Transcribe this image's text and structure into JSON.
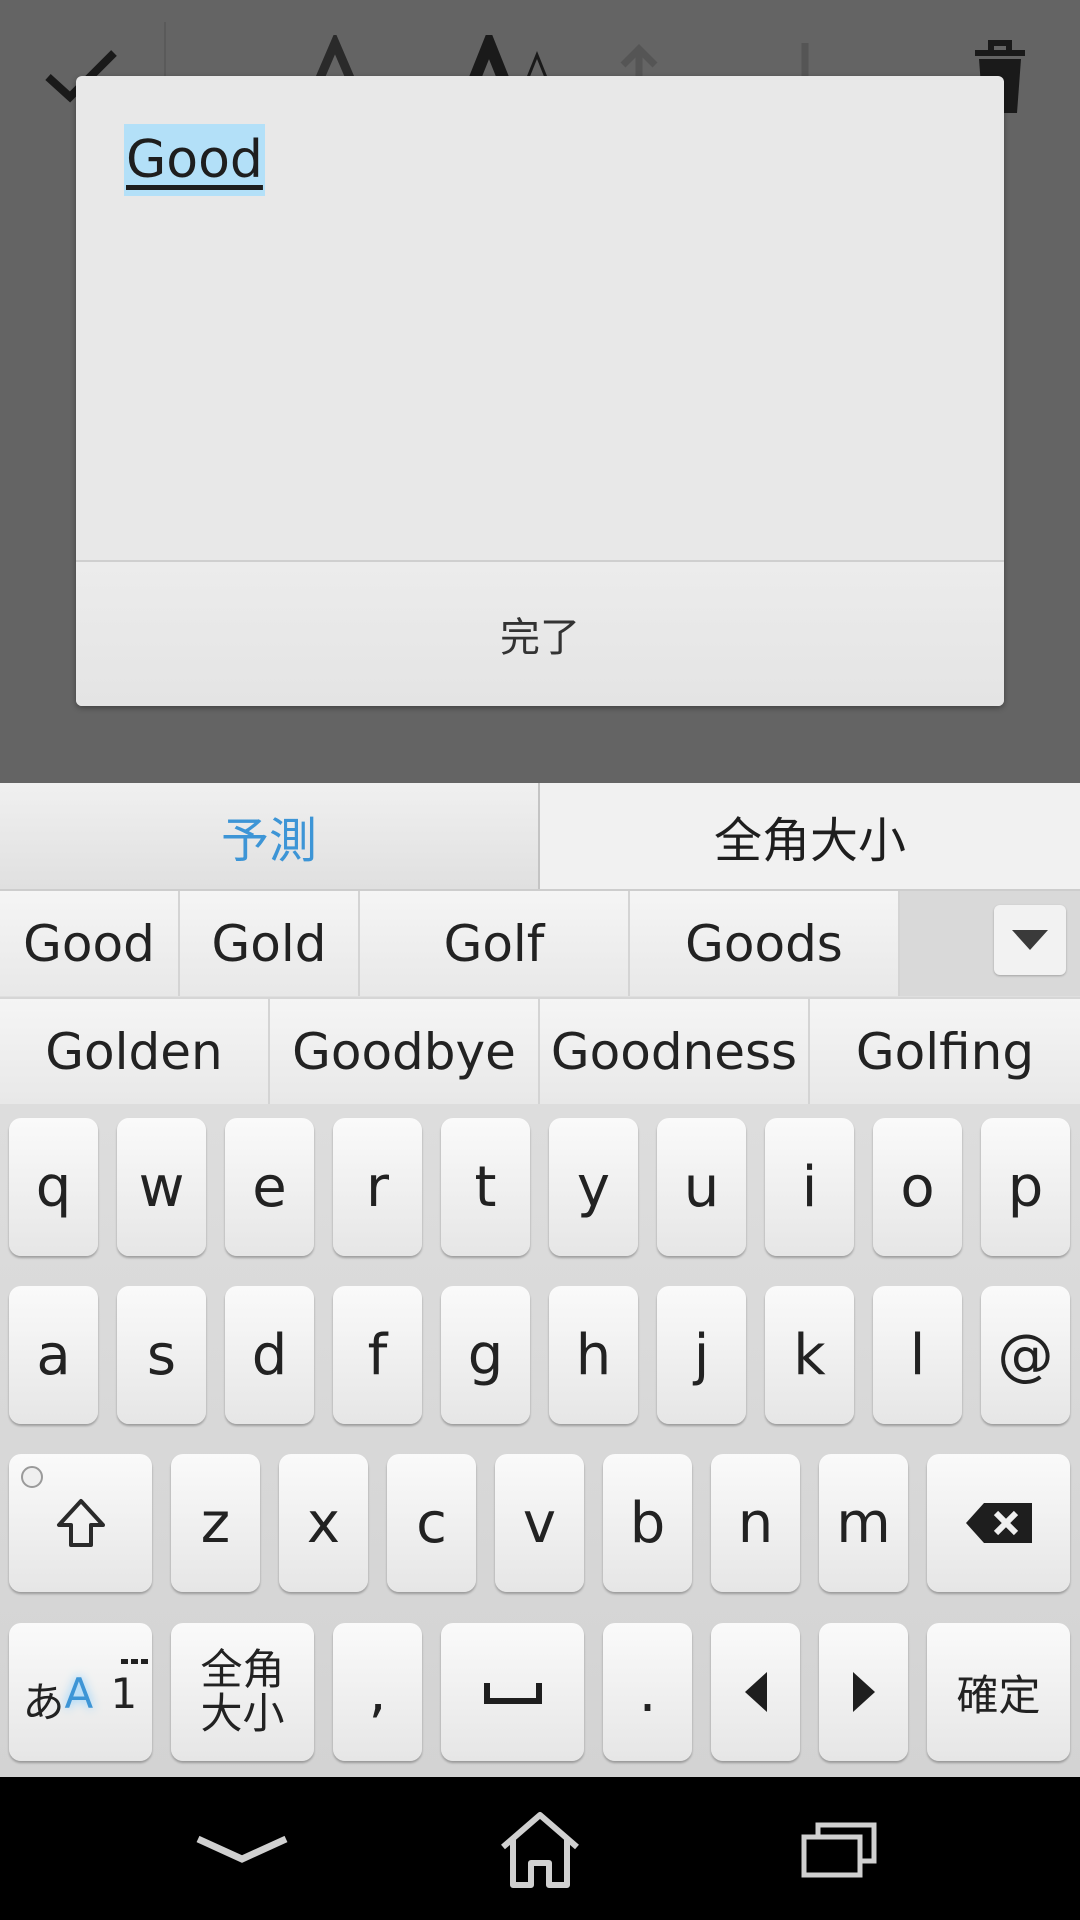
{
  "toolbar": {
    "confirm_icon": "check-icon",
    "decrease_font_icon": "font-size-decrease-icon",
    "increase_font_icon": "font-size-increase-icon",
    "bring_forward_icon": "bring-forward-icon",
    "send_backward_icon": "send-backward-icon",
    "delete_icon": "trash-icon"
  },
  "dialog": {
    "input_text": "Good",
    "done_label": "完了"
  },
  "keyboard": {
    "mode_tabs": [
      {
        "label": "予測",
        "active": true
      },
      {
        "label": "全角大小",
        "active": false
      }
    ],
    "candidates_row1": [
      "Good",
      "Gold",
      "Golf",
      "Goods"
    ],
    "candidates_row2": [
      "Golden",
      "Goodbye",
      "Goodness",
      "Golfing"
    ],
    "expand_icon": "triangle-down-icon",
    "row1": [
      "q",
      "w",
      "e",
      "r",
      "t",
      "y",
      "u",
      "i",
      "o",
      "p"
    ],
    "row2": [
      "a",
      "s",
      "d",
      "f",
      "g",
      "h",
      "j",
      "k",
      "l",
      "@"
    ],
    "row3": [
      "z",
      "x",
      "c",
      "v",
      "b",
      "n",
      "m"
    ],
    "shift_icon": "shift-icon",
    "backspace_icon": "backspace-icon",
    "bottom": {
      "input_mode": {
        "hira": "あ",
        "alpha": "A",
        "num": "1"
      },
      "zenkaku_line1": "全角",
      "zenkaku_line2": "大小",
      "comma": ",",
      "space_icon": "space-bar-icon",
      "period": ".",
      "left_icon": "cursor-left-icon",
      "right_icon": "cursor-right-icon",
      "enter": "確定"
    }
  },
  "navbar": {
    "back_icon": "back-icon",
    "home_icon": "home-icon",
    "recents_icon": "recent-apps-icon"
  },
  "colors": {
    "accent": "#3d95d6",
    "selection": "#b3e0f8",
    "dim_background": "#646464"
  }
}
